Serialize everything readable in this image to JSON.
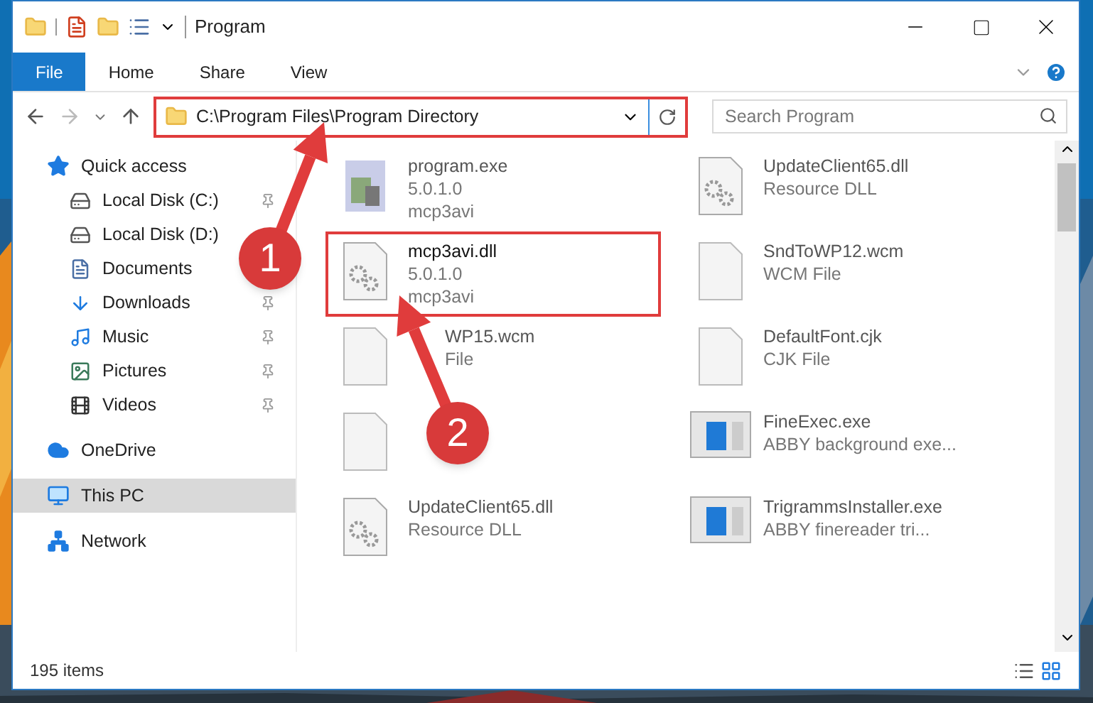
{
  "window": {
    "title": "Program"
  },
  "ribbon_tabs": [
    {
      "label": "File",
      "selected": true
    },
    {
      "label": "Home",
      "selected": false
    },
    {
      "label": "Share",
      "selected": false
    },
    {
      "label": "View",
      "selected": false
    }
  ],
  "address": {
    "path": "C:\\Program Files\\Program Directory",
    "highlighted": true
  },
  "search": {
    "placeholder": "Search Program"
  },
  "sidebar": {
    "items": [
      {
        "label": "Quick access",
        "selected": false,
        "children": [
          {
            "label": "Local Disk (C:)",
            "pinned": true,
            "selected": false
          },
          {
            "label": "Local Disk (D:)",
            "pinned": false,
            "selected": false
          },
          {
            "label": "Documents",
            "pinned": false,
            "selected": false
          },
          {
            "label": "Downloads",
            "pinned": true,
            "selected": false
          },
          {
            "label": "Music",
            "pinned": true,
            "selected": false
          },
          {
            "label": "Pictures",
            "pinned": true,
            "selected": false
          },
          {
            "label": "Videos",
            "pinned": true,
            "selected": false
          }
        ]
      },
      {
        "label": "OneDrive",
        "selected": false
      },
      {
        "label": "This PC",
        "selected": true
      },
      {
        "label": "Network",
        "selected": false
      }
    ]
  },
  "files": [
    {
      "kind": "program",
      "name": "program.exe",
      "line_2": "5.0.1.0",
      "line_3": "mcp3avi",
      "highlighted": false
    },
    {
      "kind": "dll",
      "name": "UpdateClient65.dll",
      "line_2": "Resource DLL",
      "highlighted": false
    },
    {
      "kind": "dll",
      "name": "mcp3avi.dll",
      "line_2": "5.0.1.0",
      "line_3": "mcp3avi",
      "highlighted": true
    },
    {
      "kind": "blank",
      "name": "SndToWP12.wcm",
      "line_2": "WCM File",
      "highlighted": false
    },
    {
      "kind": "blank_covered",
      "name": "WP15.wcm",
      "line_2": "File",
      "highlighted": false
    },
    {
      "kind": "blank",
      "name": "DefaultFont.cjk",
      "line_2": "CJK File",
      "highlighted": false
    },
    {
      "kind": "blank",
      "highlighted": false
    },
    {
      "kind": "app",
      "name": "FineExec.exe",
      "line_2": "ABBY background exe...",
      "highlighted": false
    },
    {
      "kind": "dll",
      "name": "UpdateClient65.dll",
      "line_2": "Resource DLL",
      "highlighted": false
    },
    {
      "kind": "app",
      "name": "TrigrammsInstaller.exe",
      "line_2": "ABBY finereader tri...",
      "highlighted": false
    }
  ],
  "status_bar": {
    "item_count": "195 items"
  },
  "annotations": [
    {
      "label": "1"
    },
    {
      "label": "2"
    }
  ]
}
